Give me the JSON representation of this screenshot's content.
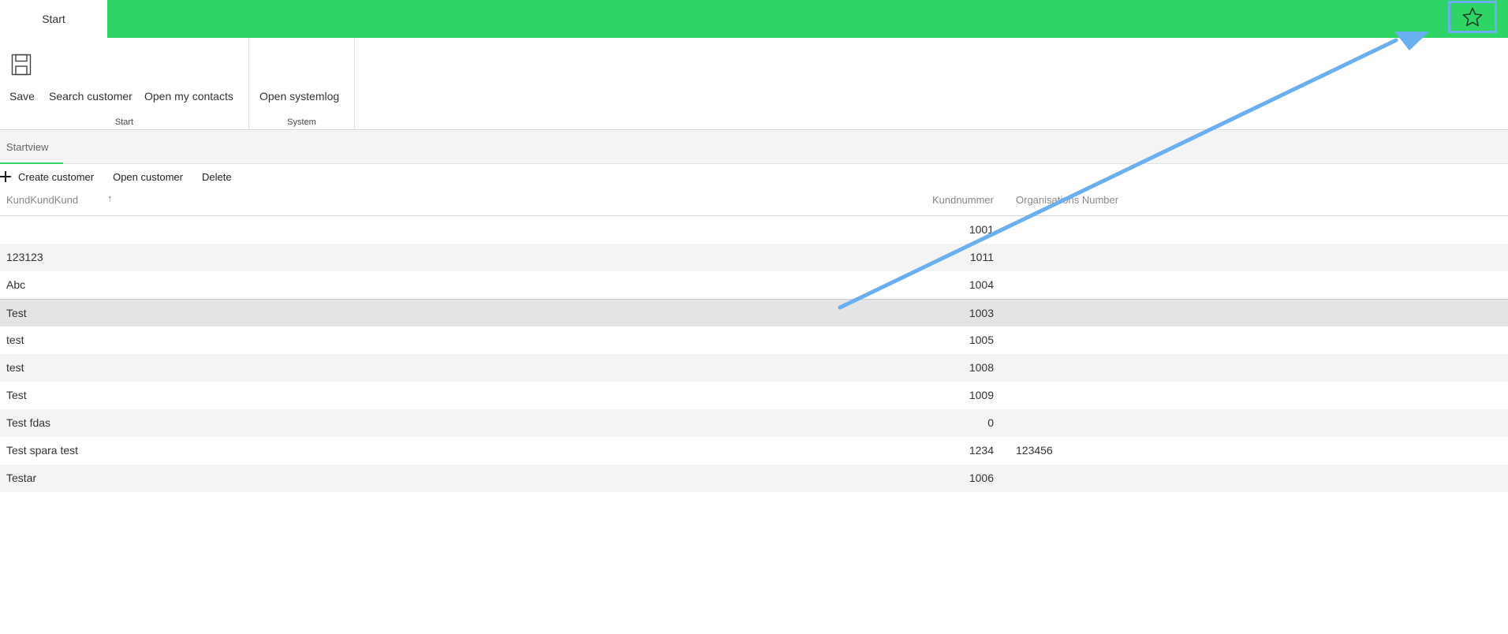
{
  "app": {
    "start_tab": "Start"
  },
  "header": {
    "favorite_icon": "star-icon",
    "accent_color": "#2ed565"
  },
  "ribbon": {
    "groups": [
      {
        "label": "Start",
        "buttons": [
          {
            "label": "Save",
            "icon": "save-icon"
          },
          {
            "label": "Search customer"
          },
          {
            "label": "Open my contacts"
          }
        ]
      },
      {
        "label": "System",
        "buttons": [
          {
            "label": "Open systemlog"
          }
        ]
      }
    ]
  },
  "views": {
    "active_tab": "Startview"
  },
  "toolbar": {
    "create_label": "Create customer",
    "create_icon": "plus-icon",
    "open_label": "Open customer",
    "delete_label": "Delete"
  },
  "table": {
    "columns": {
      "name": "KundKundKund",
      "sort_indicator": "↑",
      "number": "Kundnummer",
      "org": "Organisations Number"
    },
    "rows": [
      {
        "name": "",
        "number": "1001",
        "org": ""
      },
      {
        "name": "123123",
        "number": "1011",
        "org": ""
      },
      {
        "name": "Abc",
        "number": "1004",
        "org": ""
      },
      {
        "name": "Test",
        "number": "1003",
        "org": "",
        "selected": true
      },
      {
        "name": "test",
        "number": "1005",
        "org": ""
      },
      {
        "name": "test",
        "number": "1008",
        "org": ""
      },
      {
        "name": "Test",
        "number": "1009",
        "org": ""
      },
      {
        "name": "Test fdas",
        "number": "0",
        "org": ""
      },
      {
        "name": "Test spara test",
        "number": "1234",
        "org": "123456"
      },
      {
        "name": "Testar",
        "number": "1006",
        "org": ""
      }
    ]
  },
  "annotation": {
    "arrow_color": "#6aaff0"
  }
}
